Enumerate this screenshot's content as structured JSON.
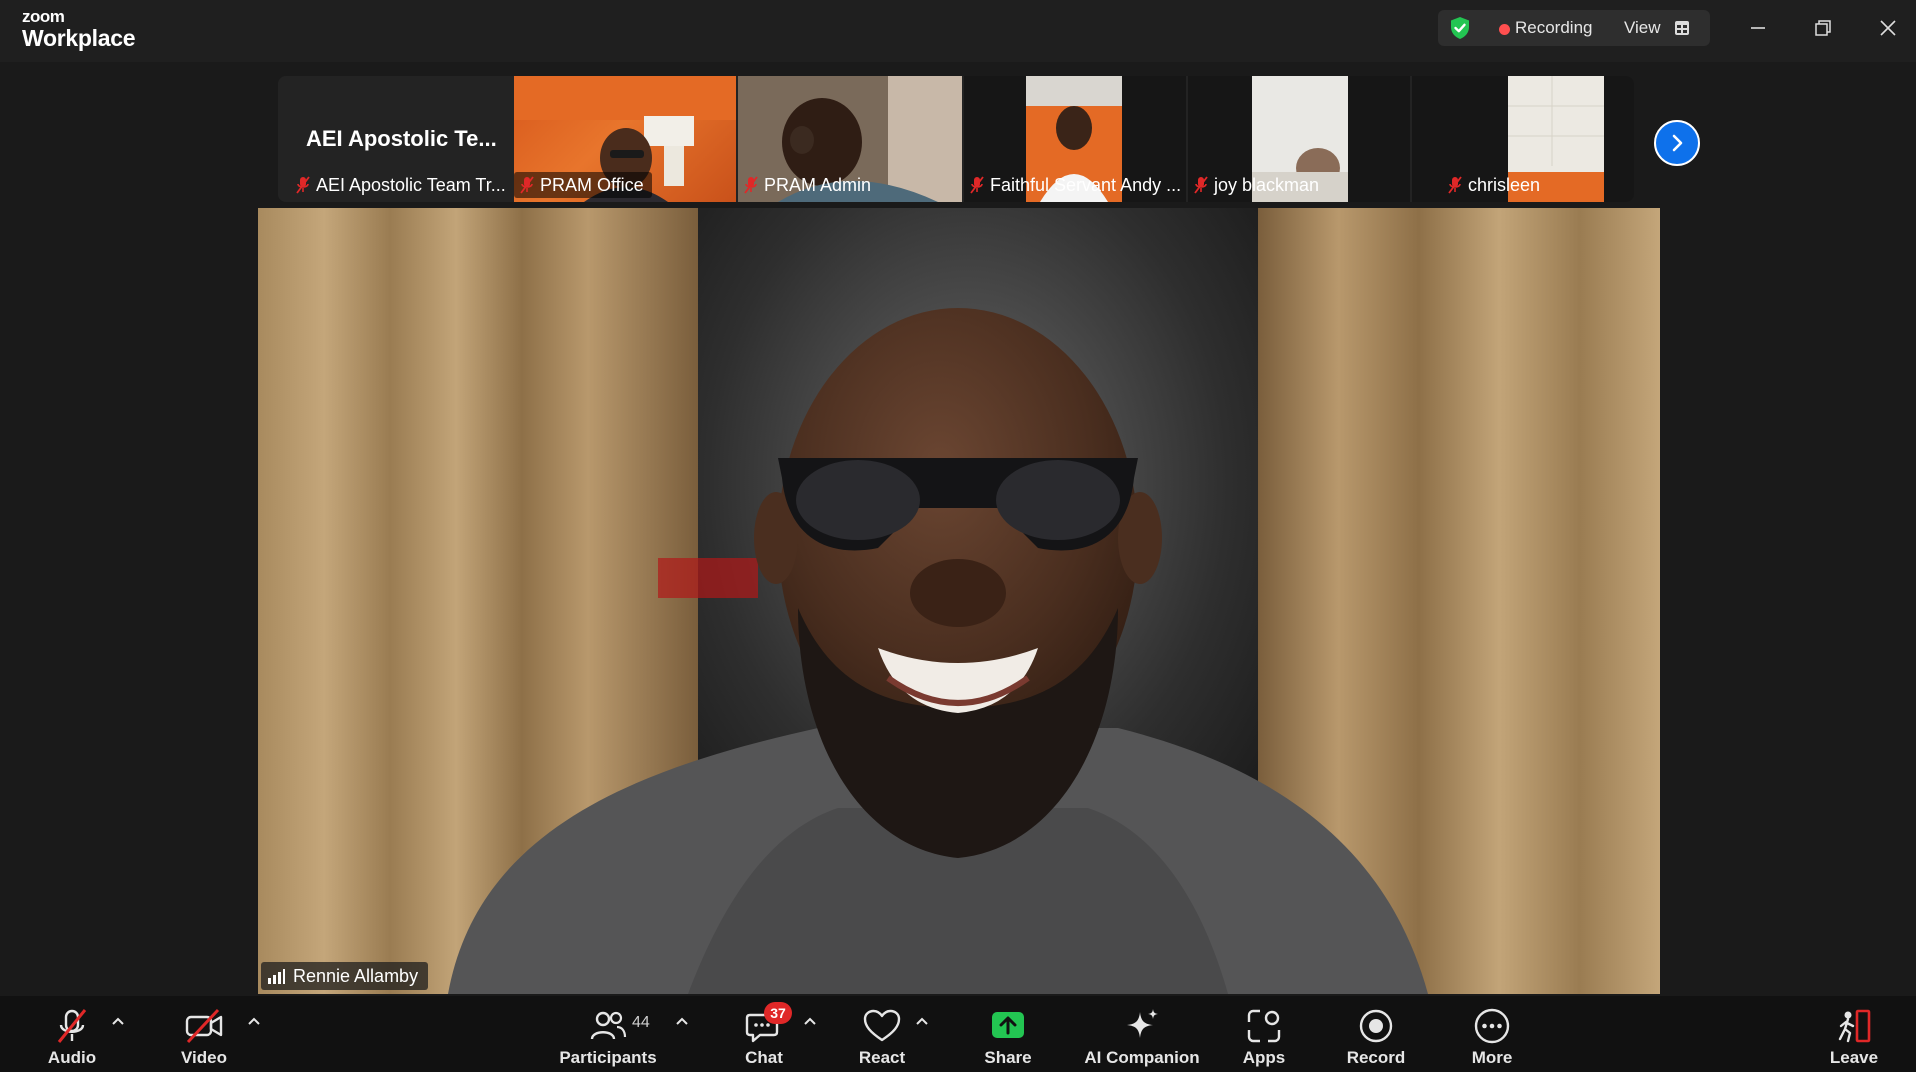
{
  "app": {
    "brand_small": "zoom",
    "brand_large": "Workplace"
  },
  "status": {
    "recording_label": "Recording",
    "view_label": "View"
  },
  "colors": {
    "accent": "#0e71eb",
    "recording": "#ff4f4f",
    "muted": "#e02828",
    "secure": "#23c552",
    "share": "#23c552"
  },
  "strip": {
    "group_tile": {
      "title": "AEI Apostolic Te...",
      "name": "AEI Apostolic Team Tr..."
    },
    "tiles": [
      {
        "name": "PRAM Office",
        "muted": true
      },
      {
        "name": "PRAM Admin",
        "muted": true
      },
      {
        "name": "Faithful Servant Andy ...",
        "muted": true
      },
      {
        "name": "joy  blackman",
        "muted": true
      },
      {
        "name": "chrisleen",
        "muted": true
      }
    ]
  },
  "main_speaker": {
    "name": "Rennie Allamby"
  },
  "toolbar": {
    "audio": "Audio",
    "video": "Video",
    "participants": "Participants",
    "participants_count": "44",
    "chat": "Chat",
    "chat_badge": "37",
    "react": "React",
    "share": "Share",
    "ai_companion": "AI Companion",
    "apps": "Apps",
    "record": "Record",
    "more": "More",
    "leave": "Leave"
  }
}
